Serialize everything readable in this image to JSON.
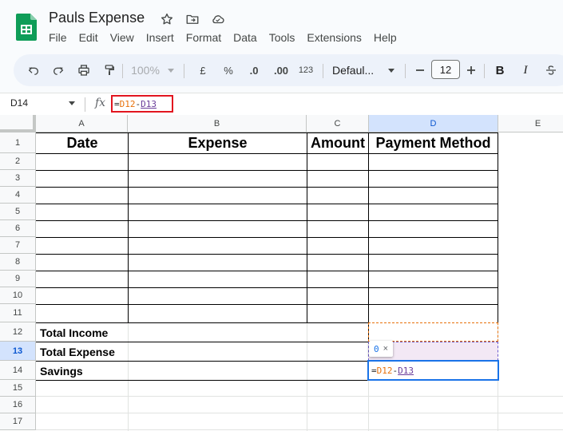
{
  "doc": {
    "title": "Pauls Expense"
  },
  "menu": [
    "File",
    "Edit",
    "View",
    "Insert",
    "Format",
    "Data",
    "Tools",
    "Extensions",
    "Help"
  ],
  "toolbar": {
    "zoom": "100%",
    "currency": "£",
    "percent": "%",
    "dec_decrease": ".0",
    "dec_increase": ".00",
    "number_format": "123",
    "font": "Defaul...",
    "font_size": "12",
    "bold": "B",
    "italic": "I"
  },
  "formula_bar": {
    "name_box": "D14",
    "fx": "fx",
    "formula_eq": "=",
    "formula_ref1": "D12",
    "formula_op": "-",
    "formula_ref2": "D13"
  },
  "grid": {
    "columns": [
      "A",
      "B",
      "C",
      "D",
      "E"
    ],
    "rows": [
      "1",
      "2",
      "3",
      "4",
      "5",
      "6",
      "7",
      "8",
      "9",
      "10",
      "11",
      "12",
      "13",
      "14",
      "15",
      "16",
      "17"
    ],
    "headers": {
      "date": "Date",
      "expense": "Expense",
      "amount": "Amount",
      "payment": "Payment Method"
    },
    "labels": {
      "total_income": "Total Income",
      "total_expense": "Total Expense",
      "savings": "Savings"
    }
  },
  "editor": {
    "eq": "=",
    "ref1": "D12",
    "op": "-",
    "ref2": "D13"
  },
  "tooltip": {
    "value": "0",
    "close": "×"
  },
  "colors": {
    "accent": "#1a73e8",
    "ref1": "#e8710a",
    "ref2": "#6a3d9a",
    "highlight": "#e2151f"
  }
}
